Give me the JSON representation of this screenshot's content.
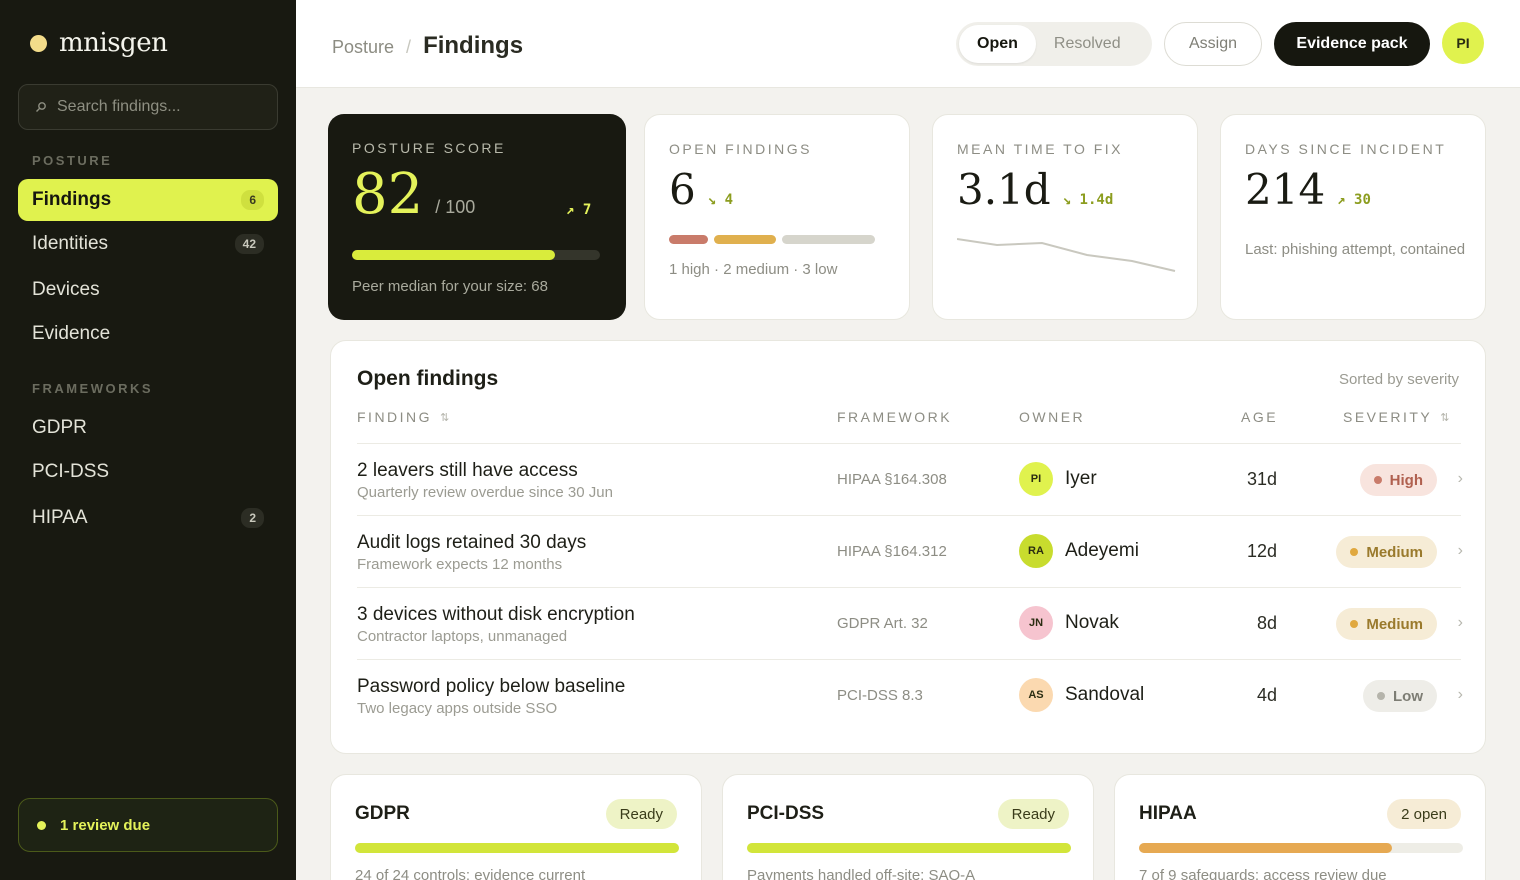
{
  "brand": {
    "name": "mnisgen"
  },
  "search": {
    "placeholder": "Search findings..."
  },
  "sidebar": {
    "sections": [
      {
        "title": "POSTURE"
      },
      {
        "title": "FRAMEWORKS"
      }
    ],
    "items": [
      {
        "label": "Findings",
        "count": "6",
        "active": true
      },
      {
        "label": "Identities",
        "count": "42"
      },
      {
        "label": "Devices"
      },
      {
        "label": "Evidence"
      },
      {
        "label": "GDPR"
      },
      {
        "label": "PCI-DSS"
      },
      {
        "label": "HIPAA",
        "count": "2"
      }
    ],
    "review_label": "1 review due"
  },
  "header": {
    "breadcrumb_parent": "Posture",
    "breadcrumb_sep": "/",
    "title": "Findings",
    "seg_open": "Open",
    "seg_resolved": "Resolved",
    "assign_label": "Assign",
    "evidence_label": "Evidence pack",
    "user_initials": "PI"
  },
  "metrics": {
    "posture": {
      "label": "POSTURE SCORE",
      "value": "82",
      "of": "/ 100",
      "delta": "↗ 7",
      "progress": 0.82,
      "note": "Peer median for your size: 68"
    },
    "open": {
      "label": "OPEN FINDINGS",
      "value": "6",
      "delta": "↘ 4",
      "note": "1 high · 2 medium · 3 low",
      "high": 1,
      "medium": 2,
      "low": 3
    },
    "mttf": {
      "label": "MEAN TIME TO FIX",
      "value": "3.1d",
      "delta": "↘ 1.4d"
    },
    "incident": {
      "label": "DAYS SINCE INCIDENT",
      "value": "214",
      "delta": "↗ 30",
      "note": "Last: phishing attempt, contained"
    }
  },
  "table": {
    "title": "Open findings",
    "sort_note": "Sorted by severity",
    "headers": {
      "finding": "FINDING",
      "framework": "FRAMEWORK",
      "owner": "OWNER",
      "age": "AGE",
      "severity": "SEVERITY",
      "sort_icon": "⇅"
    },
    "rows": [
      {
        "title": "2 leavers still have access",
        "sub": "Quarterly review overdue since 30 Jun",
        "framework": "HIPAA §164.308",
        "initials": "PI",
        "owner": "Iyer",
        "age": "31d",
        "severity": "High"
      },
      {
        "title": "Audit logs retained 30 days",
        "sub": "Framework expects 12 months",
        "framework": "HIPAA §164.312",
        "initials": "RA",
        "owner": "Adeyemi",
        "age": "12d",
        "severity": "Medium"
      },
      {
        "title": "3 devices without disk encryption",
        "sub": "Contractor laptops, unmanaged",
        "framework": "GDPR Art. 32",
        "initials": "JN",
        "owner": "Novak",
        "age": "8d",
        "severity": "Medium"
      },
      {
        "title": "Password policy below baseline",
        "sub": "Two legacy apps outside SSO",
        "framework": "PCI-DSS 8.3",
        "initials": "AS",
        "owner": "Sandoval",
        "age": "4d",
        "severity": "Low"
      }
    ]
  },
  "frameworks": [
    {
      "name": "GDPR",
      "status": "Ready",
      "progress": 1.0,
      "note": "24 of 24 controls: evidence current"
    },
    {
      "name": "PCI-DSS",
      "status": "Ready",
      "progress": 1.0,
      "note": "Payments handled off-site; SAQ-A"
    },
    {
      "name": "HIPAA",
      "status": "2 open",
      "progress": 0.78,
      "note": "7 of 9 safeguards; access review due"
    }
  ],
  "colors": {
    "accent": "#e0f24e",
    "high": "#c97b6a",
    "medium": "#e0b04e",
    "low": "#b5b4ab",
    "sidebar": "#181911"
  }
}
